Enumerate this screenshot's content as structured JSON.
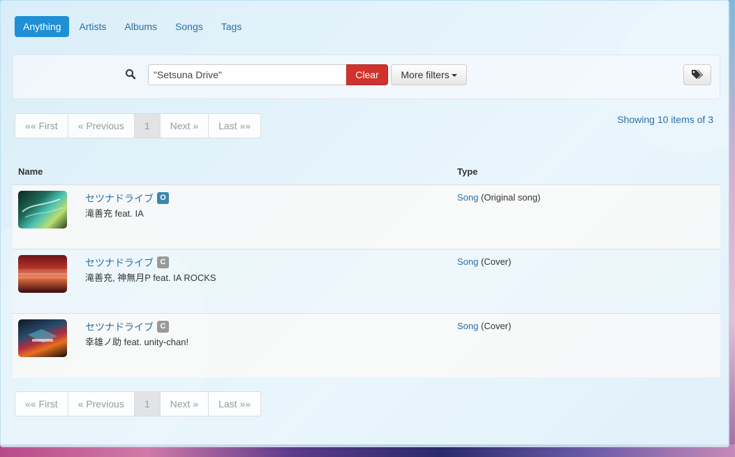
{
  "tabs": [
    {
      "label": "Anything",
      "active": true
    },
    {
      "label": "Artists",
      "active": false
    },
    {
      "label": "Albums",
      "active": false
    },
    {
      "label": "Songs",
      "active": false
    },
    {
      "label": "Tags",
      "active": false
    }
  ],
  "search": {
    "value": "\"Setsuna Drive\"",
    "clear_label": "Clear",
    "more_filters_label": "More filters"
  },
  "pagination": {
    "first": "«« First",
    "previous": "« Previous",
    "current": "1",
    "next": "Next »",
    "last": "Last »»"
  },
  "showing_text": "Showing 10 items of 3",
  "table": {
    "headers": {
      "name": "Name",
      "type": "Type"
    },
    "rows": [
      {
        "title": "セツナドライブ",
        "badge": "O",
        "artist": "滝善充 feat. IA",
        "type_link": "Song",
        "type_detail": "(Original song)"
      },
      {
        "title": "セツナドライブ",
        "badge": "C",
        "artist": "滝善充, 神無月P feat. IA ROCKS",
        "type_link": "Song",
        "type_detail": "(Cover)"
      },
      {
        "title": "セツナドライブ",
        "badge": "C",
        "artist": "幸雄ノ助 feat. unity-chan!",
        "type_link": "Song",
        "type_detail": "(Cover)"
      }
    ]
  },
  "colors": {
    "primary": "#1f8fd6",
    "link": "#2a6fa8",
    "danger": "#d2322d",
    "badge_original": "#3a87ad",
    "badge_cover": "#999999"
  },
  "icons": [
    "search-icon",
    "tags-icon",
    "caret-down-icon"
  ]
}
